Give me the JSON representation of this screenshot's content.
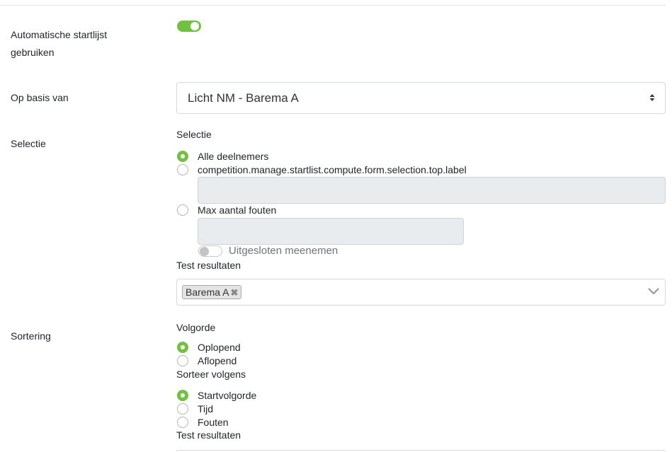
{
  "settings": {
    "auto_startlist_label_line1": "Automatische startlijst",
    "auto_startlist_label_line2": "gebruiken",
    "auto_startlist_enabled": true,
    "basis_label": "Op basis van",
    "basis_value": "Licht NM - Barema A",
    "selectie_label": "Selectie",
    "sortering_label": "Sortering"
  },
  "selection": {
    "heading": "Selectie",
    "options": [
      {
        "label": "Alle deelnemers",
        "checked": true
      },
      {
        "label": "competition.manage.startlist.compute.form.selection.top.label",
        "checked": false
      },
      {
        "label": "Max aantal fouten",
        "checked": false
      }
    ],
    "top_input_value": "",
    "max_faults_input_value": "",
    "include_excluded_label": "Uitgesloten meenemen",
    "include_excluded_enabled": false,
    "test_results_label": "Test resultaten",
    "test_results_tags": [
      "Barema A"
    ]
  },
  "sorting": {
    "order_heading": "Volgorde",
    "order_options": [
      {
        "label": "Oplopend",
        "checked": true
      },
      {
        "label": "Aflopend",
        "checked": false
      }
    ],
    "sort_by_heading": "Sorteer volgens",
    "sort_by_options": [
      {
        "label": "Startvolgorde",
        "checked": true
      },
      {
        "label": "Tijd",
        "checked": false
      },
      {
        "label": "Fouten",
        "checked": false
      }
    ],
    "test_results_label": "Test resultaten"
  },
  "colors": {
    "accent": "#72c040",
    "input_disabled": "#e9ecef",
    "border": "#d6d9dc"
  }
}
